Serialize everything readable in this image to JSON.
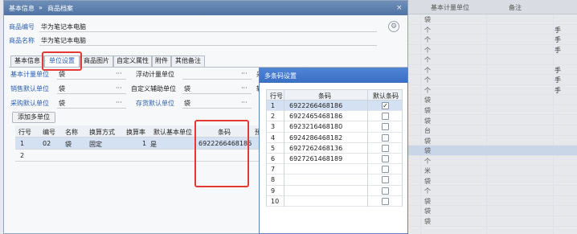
{
  "background_grid": {
    "headers": [
      "基本计量单位",
      "备注"
    ],
    "rows": [
      {
        "unit": "袋",
        "side": ""
      },
      {
        "unit": "个",
        "side": "手"
      },
      {
        "unit": "个",
        "side": "手"
      },
      {
        "unit": "个",
        "side": "手"
      },
      {
        "unit": "个",
        "side": ""
      },
      {
        "unit": "个",
        "side": "手"
      },
      {
        "unit": "个",
        "side": "手"
      },
      {
        "unit": "个",
        "side": "手"
      },
      {
        "unit": "袋",
        "side": ""
      },
      {
        "unit": "袋",
        "side": ""
      },
      {
        "unit": "袋",
        "side": ""
      },
      {
        "unit": "台",
        "side": ""
      },
      {
        "unit": "袋",
        "side": ""
      },
      {
        "unit": "袋",
        "side": ""
      },
      {
        "unit": "个",
        "side": ""
      },
      {
        "unit": "米",
        "side": ""
      },
      {
        "unit": "袋",
        "side": ""
      },
      {
        "unit": "个",
        "side": ""
      },
      {
        "unit": "袋",
        "side": ""
      },
      {
        "unit": "袋",
        "side": ""
      },
      {
        "unit": "袋",
        "side": ""
      }
    ]
  },
  "dialog": {
    "breadcrumb_1": "基本信息",
    "breadcrumb_sep": "»",
    "breadcrumb_2": "商品档案",
    "close": "×",
    "code_label": "商品编号",
    "code_value": "华为笔记本电脑",
    "name_label": "商品名称",
    "name_value": "华为笔记本电脑",
    "tabs": [
      "基本信息",
      "单位设置",
      "商品图片",
      "自定义属性",
      "附件",
      "其他备注"
    ],
    "fields": {
      "base_unit_label": "基本计量单位",
      "base_unit_value": "袋",
      "float_unit_label": "浮动计量单位",
      "float_unit_value": "",
      "sales_unit_label": "销售默认单位",
      "sales_unit_value": "袋",
      "custom_aux_label": "自定义辅助单位",
      "custom_aux_value": "袋",
      "purchase_unit_label": "采购默认单位",
      "purchase_unit_value": "袋",
      "stock_unit_label": "存货默认单位",
      "stock_unit_value": "袋",
      "trunc_1": "采",
      "trunc_2": "辑",
      "ellipsis": "···"
    },
    "add_multi_unit": "添加多单位",
    "grid_headers": [
      "行号",
      "编号",
      "名称",
      "换算方式",
      "换算率",
      "默认基本单位",
      "条码",
      "预"
    ],
    "grid_rows": [
      {
        "no": "1",
        "code": "02",
        "name": "袋",
        "method": "固定",
        "rate": "1",
        "default": "是",
        "barcode": "6922266468186"
      },
      {
        "no": "2",
        "code": "",
        "name": "",
        "method": "",
        "rate": "",
        "default": "",
        "barcode": ""
      }
    ]
  },
  "popup": {
    "title": "多条码设置",
    "headers": [
      "行号",
      "条码",
      "默认条码"
    ],
    "rows": [
      {
        "no": "1",
        "barcode": "6922266468186",
        "checked": true
      },
      {
        "no": "2",
        "barcode": "6922465468186",
        "checked": false
      },
      {
        "no": "3",
        "barcode": "6923216468180",
        "checked": false
      },
      {
        "no": "4",
        "barcode": "6924286468182",
        "checked": false
      },
      {
        "no": "5",
        "barcode": "6927262468136",
        "checked": false
      },
      {
        "no": "6",
        "barcode": "6927261468189",
        "checked": false
      },
      {
        "no": "7",
        "barcode": "",
        "checked": false
      },
      {
        "no": "8",
        "barcode": "",
        "checked": false
      },
      {
        "no": "9",
        "barcode": "",
        "checked": false
      },
      {
        "no": "10",
        "barcode": "",
        "checked": false
      }
    ],
    "check_mark": "✓"
  },
  "colors": {
    "highlight": "#e53935",
    "accent": "#2a5fb0",
    "selection": "#d4e1f3"
  }
}
